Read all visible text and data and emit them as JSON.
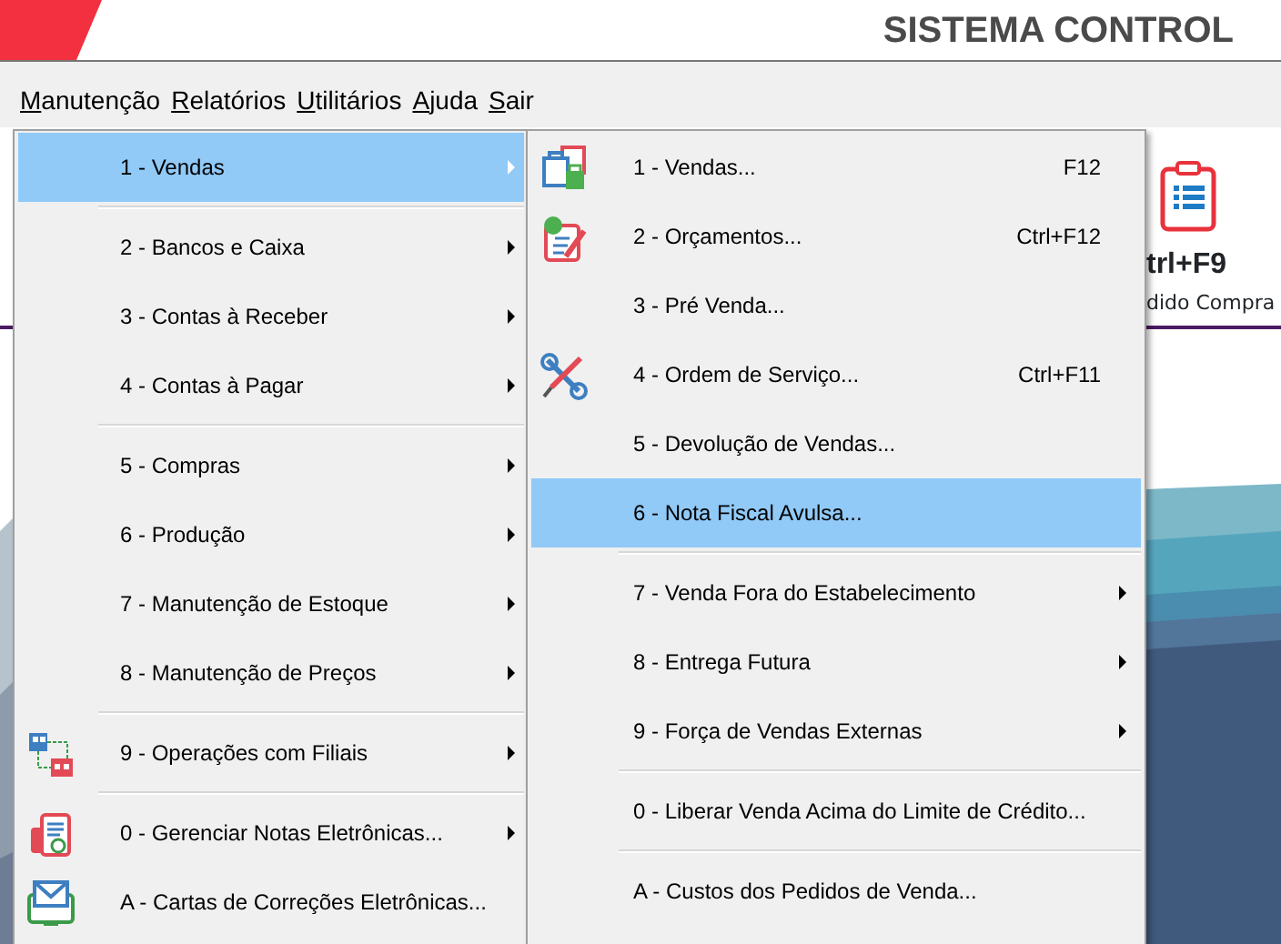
{
  "header": {
    "title": "SISTEMA CONTROL"
  },
  "menubar": [
    {
      "label": "Manutenção"
    },
    {
      "label": "Relatórios"
    },
    {
      "label": "Utilitários"
    },
    {
      "label": "Ajuda"
    },
    {
      "label": "Sair"
    }
  ],
  "toolbar_button": {
    "shortcut": "trl+F9",
    "label": "dido Compra"
  },
  "menu": {
    "items": [
      {
        "kind": "item",
        "label": "1 - Vendas",
        "selected": true,
        "submenu": true
      },
      {
        "kind": "separator"
      },
      {
        "kind": "item",
        "label": "2 - Bancos e Caixa",
        "selected": false,
        "submenu": true
      },
      {
        "kind": "item",
        "label": "3 - Contas à Receber",
        "selected": false,
        "submenu": true
      },
      {
        "kind": "item",
        "label": "4 - Contas à Pagar",
        "selected": false,
        "submenu": true
      },
      {
        "kind": "separator"
      },
      {
        "kind": "item",
        "label": "5 - Compras",
        "selected": false,
        "submenu": true
      },
      {
        "kind": "item",
        "label": "6 - Produção",
        "selected": false,
        "submenu": true
      },
      {
        "kind": "item",
        "label": "7 - Manutenção de Estoque",
        "selected": false,
        "submenu": true
      },
      {
        "kind": "item",
        "label": "8 - Manutenção de Preços",
        "selected": false,
        "submenu": true
      },
      {
        "kind": "separator"
      },
      {
        "kind": "item",
        "label": "9 - Operações com Filiais",
        "selected": false,
        "submenu": true
      },
      {
        "kind": "separator"
      },
      {
        "kind": "item",
        "label": "0 - Gerenciar Notas Eletrônicas...",
        "selected": false,
        "submenu": true
      },
      {
        "kind": "item",
        "label": "A - Cartas de Correções Eletrônicas...",
        "selected": false,
        "submenu": false
      }
    ]
  },
  "submenu": {
    "items": [
      {
        "kind": "item",
        "label": "1 - Vendas...",
        "shortcut": "F12",
        "selected": false,
        "submenu": false
      },
      {
        "kind": "item",
        "label": "2 - Orçamentos...",
        "shortcut": "Ctrl+F12",
        "selected": false,
        "submenu": false
      },
      {
        "kind": "item",
        "label": "3 - Pré Venda...",
        "selected": false,
        "submenu": false
      },
      {
        "kind": "item",
        "label": "4 - Ordem de Serviço...",
        "shortcut": "Ctrl+F11",
        "selected": false,
        "submenu": false
      },
      {
        "kind": "item",
        "label": "5 - Devolução de Vendas...",
        "selected": false,
        "submenu": false
      },
      {
        "kind": "item",
        "label": "6 - Nota Fiscal Avulsa...",
        "selected": true,
        "submenu": false
      },
      {
        "kind": "separator"
      },
      {
        "kind": "item",
        "label": "7 - Venda Fora do Estabelecimento",
        "selected": false,
        "submenu": true
      },
      {
        "kind": "item",
        "label": "8 - Entrega Futura",
        "selected": false,
        "submenu": true
      },
      {
        "kind": "item",
        "label": "9 - Força de Vendas Externas",
        "selected": false,
        "submenu": true
      },
      {
        "kind": "separator"
      },
      {
        "kind": "item",
        "label": "0 - Liberar Venda Acima do Limite de Crédito...",
        "selected": false,
        "submenu": false
      },
      {
        "kind": "separator"
      },
      {
        "kind": "item",
        "label": "A - Custos dos Pedidos de Venda...",
        "selected": false,
        "submenu": false
      }
    ]
  }
}
